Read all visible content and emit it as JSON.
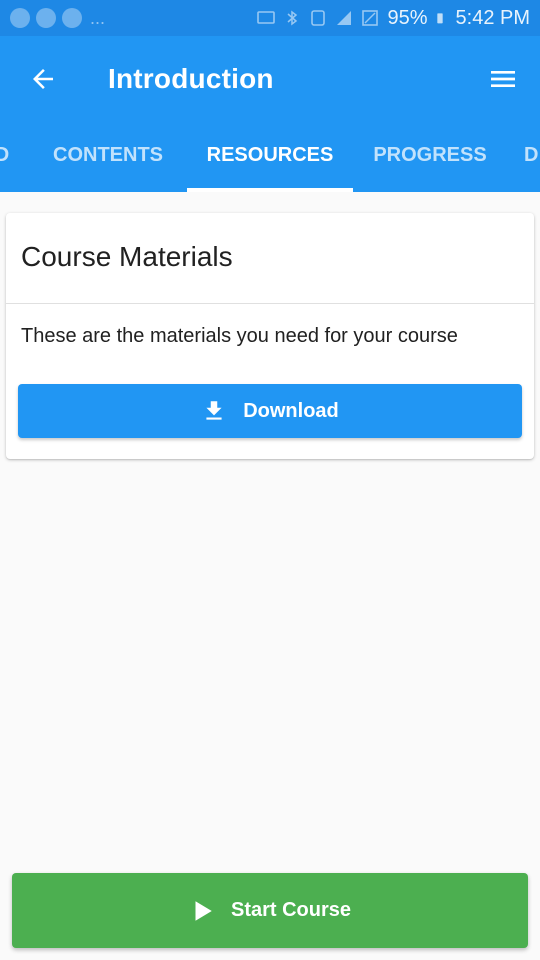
{
  "status_bar": {
    "overflow_dots": "...",
    "battery": "95%",
    "time": "5:42 PM",
    "icons": [
      "app-notification-icon",
      "app-notification-icon",
      "app-notification-icon",
      "cast-icon",
      "bluetooth-icon",
      "nfc-icon",
      "signal-icon",
      "no-sim-icon",
      "battery-icon"
    ]
  },
  "toolbar": {
    "title": "Introduction",
    "back_icon": "arrow-left-icon",
    "menu_icon": "hamburger-menu-icon"
  },
  "tabs": [
    {
      "label": "D"
    },
    {
      "label": "CONTENTS"
    },
    {
      "label": "RESOURCES",
      "active": true
    },
    {
      "label": "PROGRESS"
    },
    {
      "label": "D"
    }
  ],
  "card": {
    "title": "Course Materials",
    "text": "These are the materials you need for your course",
    "download_label": "Download",
    "download_icon": "download-icon"
  },
  "footer": {
    "start_label": "Start Course",
    "start_icon": "play-icon"
  },
  "colors": {
    "primary": "#2196f3",
    "status_bar": "#1e88e5",
    "success": "#4caf50",
    "background": "#fafafa"
  }
}
